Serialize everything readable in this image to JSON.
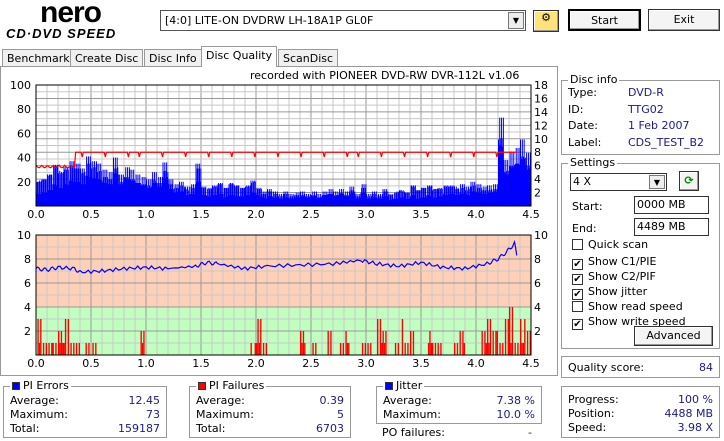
{
  "app": {
    "logo_top": "nero",
    "logo_bottom": "CD·DVD SPEED"
  },
  "toolbar": {
    "drive": "[4:0]  LITE-ON DVDRW LH-18A1P GL0F",
    "start": "Start",
    "exit": "Exit"
  },
  "tabs": [
    {
      "label": "Benchmark"
    },
    {
      "label": "Create Disc"
    },
    {
      "label": "Disc Info"
    },
    {
      "label": "Disc Quality",
      "active": true
    },
    {
      "label": "ScanDisc"
    }
  ],
  "recorded_with": "recorded with PIONEER DVD-RW  DVR-112L v1.06",
  "disc_info": {
    "title": "Disc info",
    "type_label": "Type:",
    "type": "DVD-R",
    "id_label": "ID:",
    "id": "TTG02",
    "date_label": "Date:",
    "date": "1 Feb 2007",
    "label_label": "Label:",
    "label": "CDS_TEST_B2"
  },
  "settings": {
    "title": "Settings",
    "speed": "4 X",
    "start_label": "Start:",
    "start": "0000 MB",
    "end_label": "End:",
    "end": "4489 MB",
    "checks": [
      {
        "label": "Quick scan",
        "checked": false
      },
      {
        "label": "Show C1/PIE",
        "checked": true
      },
      {
        "label": "Show C2/PIF",
        "checked": true
      },
      {
        "label": "Show jitter",
        "checked": true
      },
      {
        "label": "Show read speed",
        "checked": false
      },
      {
        "label": "Show write speed",
        "checked": true
      }
    ],
    "advanced": "Advanced"
  },
  "quality": {
    "label": "Quality score:",
    "value": "84"
  },
  "pi_errors": {
    "title": "PI Errors",
    "color": "#0000ff",
    "avg_label": "Average:",
    "avg": "12.45",
    "max_label": "Maximum:",
    "max": "73",
    "total_label": "Total:",
    "total": "159187"
  },
  "pi_failures": {
    "title": "PI Failures",
    "color": "#ff0000",
    "avg_label": "Average:",
    "avg": "0.39",
    "max_label": "Maximum:",
    "max": "5",
    "total_label": "Total:",
    "total": "6703"
  },
  "jitter": {
    "title": "Jitter",
    "color": "#0000ff",
    "avg_label": "Average:",
    "avg": "7.38 %",
    "max_label": "Maximum:",
    "max": "10.0 %",
    "po_label": "PO failures:",
    "po": "-"
  },
  "progress": {
    "progress_label": "Progress:",
    "progress": "100 %",
    "position_label": "Position:",
    "position": "4488 MB",
    "speed_label": "Speed:",
    "speed": "3.98 X"
  },
  "chart_data": [
    {
      "type": "bar",
      "xlim": [
        0,
        4.5
      ],
      "ylim": [
        0,
        100
      ],
      "y2lim": [
        0,
        18
      ],
      "grid": true,
      "xticks": [
        "0.0",
        "0.5",
        "1.0",
        "1.5",
        "2.0",
        "2.5",
        "3.0",
        "3.5",
        "4.0",
        "4.5"
      ],
      "yticks": [
        "20",
        "40",
        "60",
        "80",
        "100"
      ],
      "y2ticks": [
        "2",
        "4",
        "6",
        "8",
        "10",
        "12",
        "14",
        "16",
        "18"
      ],
      "series": [
        {
          "kind": "bar",
          "color": "#0000ff",
          "x_step": 0.05,
          "values": [
            22,
            24,
            28,
            36,
            30,
            34,
            38,
            36,
            32,
            42,
            38,
            35,
            30,
            28,
            40,
            26,
            32,
            30,
            26,
            24,
            22,
            28,
            24,
            36,
            22,
            18,
            20,
            16,
            18,
            36,
            17,
            16,
            18,
            20,
            16,
            20,
            18,
            16,
            18,
            22,
            16,
            12,
            14,
            12,
            10,
            12,
            10,
            11,
            12,
            10,
            12,
            10,
            12,
            14,
            12,
            14,
            12,
            16,
            10,
            18,
            10,
            12,
            10,
            14,
            10,
            12,
            14,
            12,
            18,
            14,
            16,
            18,
            15,
            16,
            18,
            18,
            16,
            18,
            16,
            20,
            18,
            16,
            17,
            18,
            73,
            38,
            45,
            48,
            55,
            44
          ]
        },
        {
          "kind": "line",
          "axis": "right",
          "label": "write speed",
          "color": "#ff0000",
          "points": [
            [
              0,
              5.5
            ],
            [
              0.1,
              6.1
            ],
            [
              0.2,
              6.1
            ],
            [
              0.35,
              6.1
            ],
            [
              0.36,
              8
            ],
            [
              0.55,
              8
            ],
            [
              0.56,
              7.2
            ],
            [
              0.57,
              8
            ],
            [
              1.3,
              8
            ],
            [
              1.31,
              7.3
            ],
            [
              1.5,
              8
            ],
            [
              4.37,
              8
            ]
          ]
        }
      ]
    },
    {
      "type": "bar",
      "xlim": [
        0,
        4.5
      ],
      "ylim": [
        0,
        10
      ],
      "y2lim": [
        0,
        10
      ],
      "grid": true,
      "xticks": [
        "0.0",
        "0.5",
        "1.0",
        "1.5",
        "2.0",
        "2.5",
        "3.0",
        "3.5",
        "4.0",
        "4.5"
      ],
      "yticks": [
        "2",
        "4",
        "6",
        "8",
        "10"
      ],
      "y2ticks": [
        "2",
        "4",
        "6",
        "8",
        "10"
      ],
      "bands": [
        {
          "from": 4,
          "to": 10,
          "color": "#ffd0b8"
        },
        {
          "from": 0,
          "to": 4,
          "color": "#c0ffc0"
        }
      ],
      "series": [
        {
          "kind": "bar",
          "color": "#ff0000",
          "x_step": 0.05,
          "values": [
            3,
            1,
            1,
            1,
            2,
            3,
            1,
            1,
            0,
            1,
            1,
            0,
            0,
            0,
            0,
            0,
            0,
            0,
            0,
            2,
            0,
            0,
            0,
            0,
            0,
            0,
            0,
            0,
            0,
            0,
            0,
            0,
            0,
            0,
            0,
            0,
            0,
            0,
            0,
            1,
            3,
            1,
            0,
            0,
            0,
            0,
            0,
            0,
            2,
            0,
            1,
            0,
            0,
            2,
            0,
            1,
            2,
            0,
            0,
            1,
            1,
            0,
            3,
            2,
            0,
            1,
            3,
            1,
            2,
            0,
            0,
            2,
            1,
            1,
            0,
            0,
            1,
            2,
            0,
            0,
            0,
            2,
            3,
            2,
            1,
            3,
            4,
            1,
            3,
            2
          ]
        },
        {
          "kind": "line",
          "label": "jitter",
          "color": "#0000ff",
          "points": [
            [
              0,
              7.2
            ],
            [
              0.1,
              7.1
            ],
            [
              0.2,
              7.3
            ],
            [
              0.35,
              7.2
            ],
            [
              0.4,
              6.9
            ],
            [
              0.6,
              7.0
            ],
            [
              0.8,
              7.2
            ],
            [
              1.0,
              7.3
            ],
            [
              1.2,
              7.2
            ],
            [
              1.45,
              7.4
            ],
            [
              1.55,
              7.7
            ],
            [
              1.65,
              7.6
            ],
            [
              1.9,
              7.2
            ],
            [
              2.1,
              7.4
            ],
            [
              2.4,
              7.5
            ],
            [
              2.7,
              7.6
            ],
            [
              2.95,
              7.9
            ],
            [
              3.1,
              7.6
            ],
            [
              3.3,
              7.4
            ],
            [
              3.5,
              7.7
            ],
            [
              3.7,
              7.3
            ],
            [
              3.9,
              7.2
            ],
            [
              4.1,
              7.6
            ],
            [
              4.2,
              8.0
            ],
            [
              4.28,
              8.6
            ],
            [
              4.35,
              9.3
            ],
            [
              4.37,
              8.3
            ]
          ]
        }
      ]
    }
  ]
}
